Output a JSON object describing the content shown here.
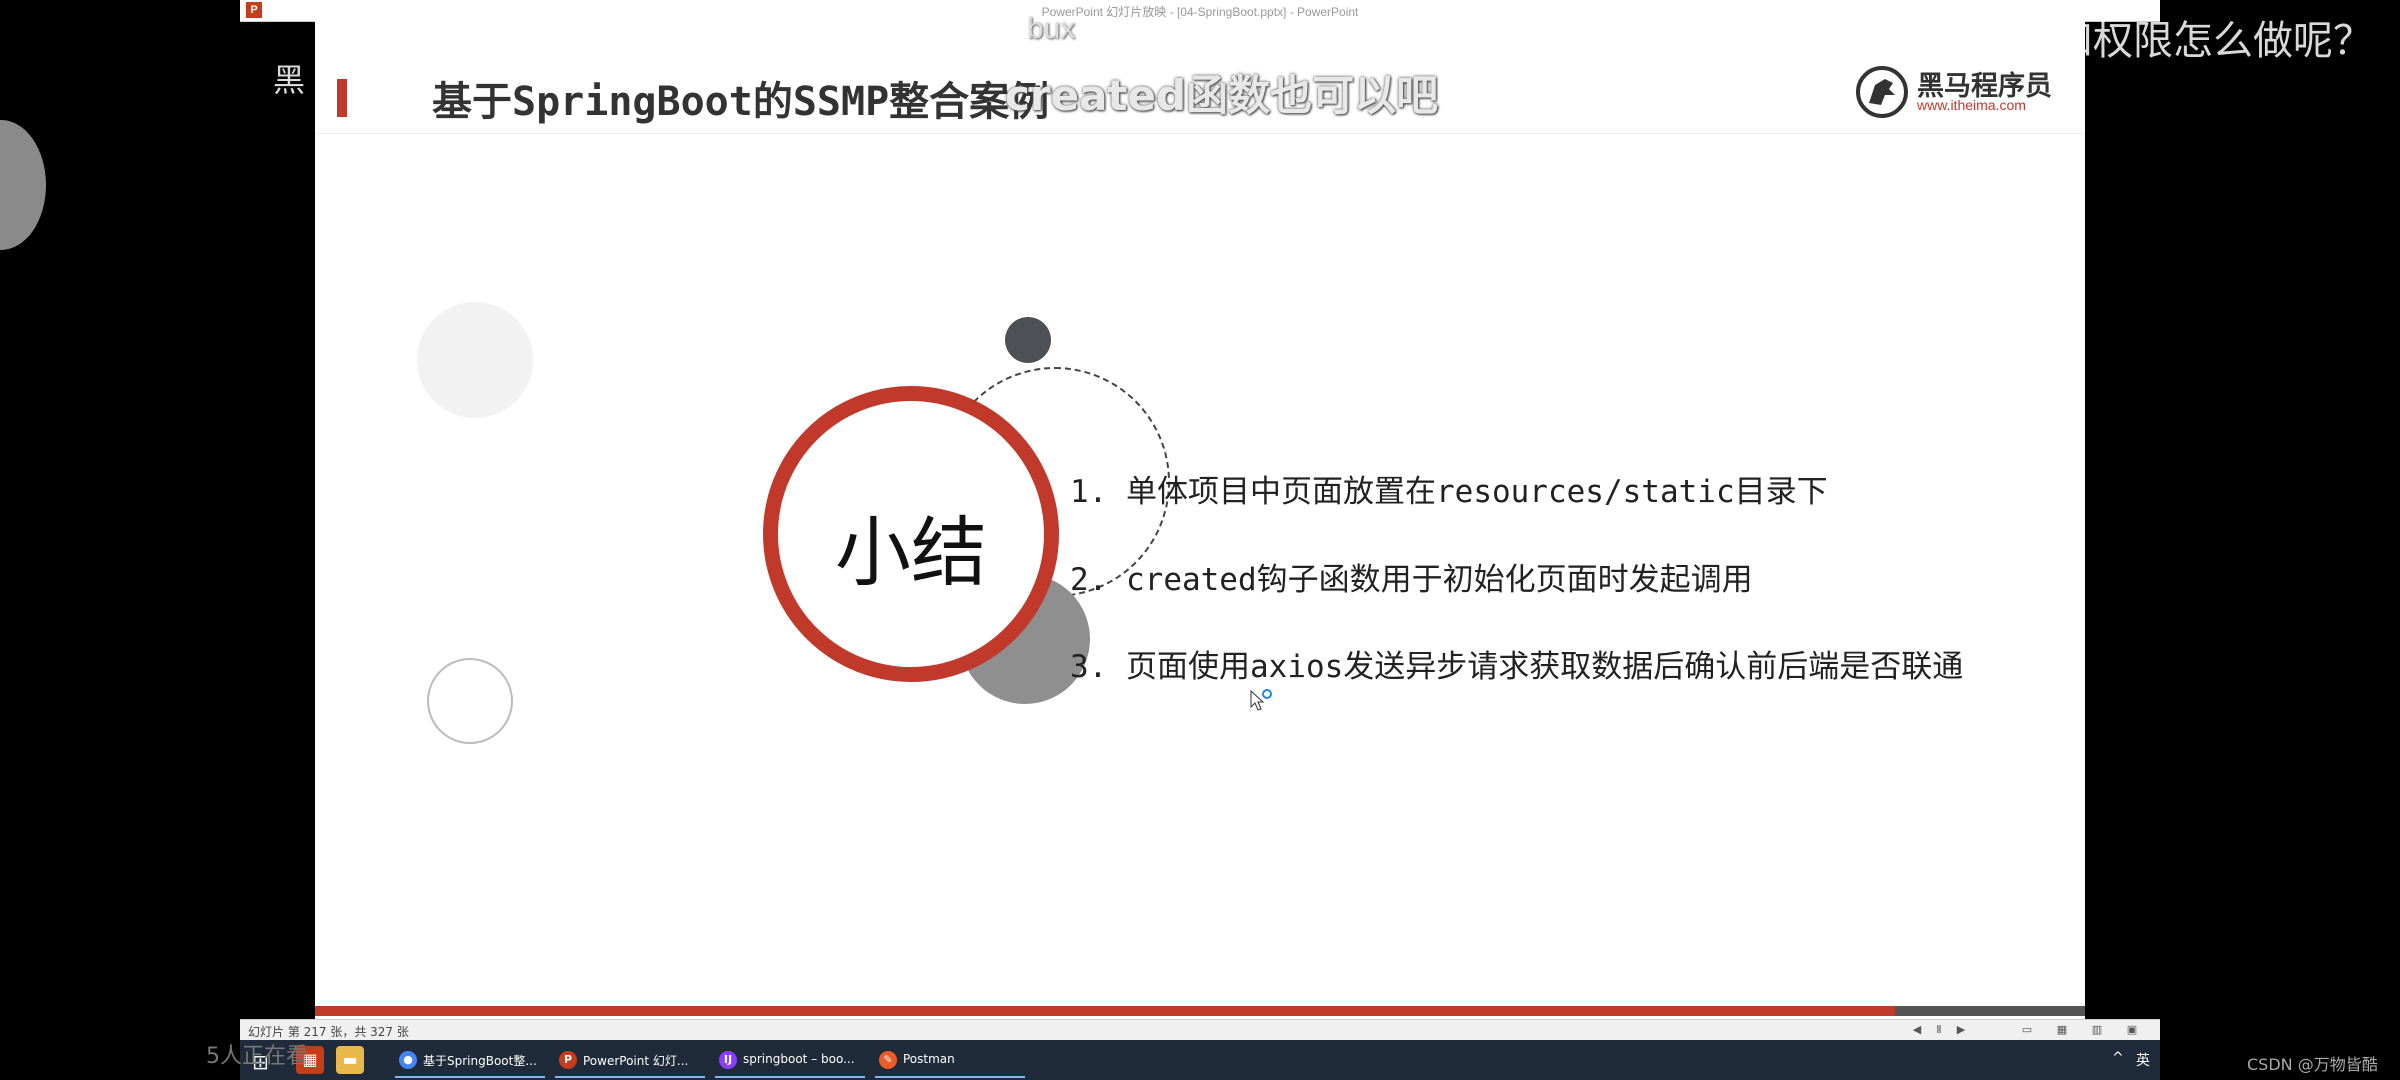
{
  "window": {
    "title": "PowerPoint 幻灯片放映 - [04-SpringBoot.pptx] - PowerPoint",
    "app_icon_letter": "P"
  },
  "slide": {
    "title": "基于SpringBoot的SSMP整合案例",
    "logo": {
      "name": "黑马程序员",
      "url": "www.itheima.com"
    },
    "circle_label": "小结",
    "points": [
      "1. 单体项目中页面放置在resources/static目录下",
      "2. created钩子函数用于初始化页面时发起调用",
      "3. 页面使用axios发送异步请求获取数据后确认前后端是否联通"
    ],
    "accent_color": "#c0392b"
  },
  "overlays": {
    "subtitle": "created函数也可以吧",
    "bux": "bux",
    "watermark_left": "黑",
    "top_right_question": "登录和权限怎么做呢？",
    "listening": "5人正在看",
    "csdn": "CSDN @万物皆酷"
  },
  "statusbar": {
    "slide_counter": "幻灯片 第 217 张，共 327 张"
  },
  "taskbar": {
    "items": [
      {
        "icon": "chrome-icon",
        "label": "基于SpringBoot整..."
      },
      {
        "icon": "powerpoint-icon",
        "label": "PowerPoint 幻灯..."
      },
      {
        "icon": "intellij-icon",
        "label": "springboot – boo..."
      },
      {
        "icon": "postman-icon",
        "label": "Postman"
      }
    ],
    "ime": "英"
  }
}
